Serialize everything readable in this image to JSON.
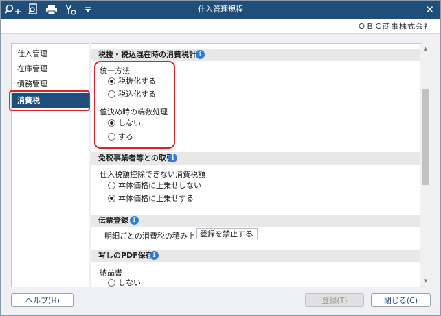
{
  "window": {
    "title": "仕入管理規程",
    "company": "ＯＢＣ商事株式会社",
    "toolbar_icons": [
      "search-plus-icon",
      "search-doc-icon",
      "print-icon",
      "accounting-icon",
      "dropdown-arrow-icon"
    ],
    "close_glyph": "✕"
  },
  "sidebar": {
    "items": [
      {
        "label": "仕入管理"
      },
      {
        "label": "在庫管理"
      },
      {
        "label": "債務管理"
      },
      {
        "label": "消費税",
        "selected": true
      }
    ]
  },
  "sections": {
    "tax_calc": {
      "title": "税抜・税込混在時の消費税計算",
      "unify_label": "統一方法",
      "unify_options": [
        "税抜化する",
        "税込化する"
      ],
      "unify_selected": "税抜化する",
      "rounding_label": "値決め時の端数処理",
      "rounding_options": [
        "しない",
        "する"
      ],
      "rounding_selected": "しない"
    },
    "exempt": {
      "title": "免税事業者等との取引",
      "label": "仕入税額控除できない消費税額",
      "options": [
        "本体価格に上乗せしない",
        "本体価格に上乗せする"
      ],
      "selected": "本体価格に上乗せする"
    },
    "voucher": {
      "title": "伝票登録",
      "label": "明細ごとの消費税の積み上げ",
      "select_value": "登録を禁止する"
    },
    "pdf": {
      "title": "写しのPDF保存",
      "label": "納品書",
      "options": [
        "しない"
      ],
      "selected": "しない"
    }
  },
  "buttons": {
    "help": "ヘルプ(H)",
    "register": "登録(T)",
    "close": "閉じる(C)"
  },
  "colors": {
    "titlebar": "#1f4e7a",
    "accent": "#2b7fd6",
    "highlight": "#e0202c"
  }
}
